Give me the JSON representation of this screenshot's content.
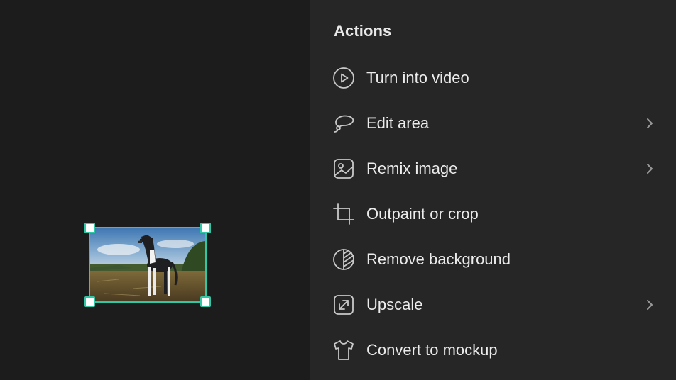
{
  "panel": {
    "title": "Actions",
    "actions": [
      {
        "label": "Turn into video",
        "icon": "play-circle-icon",
        "has_submenu": false
      },
      {
        "label": "Edit area",
        "icon": "lasso-icon",
        "has_submenu": true
      },
      {
        "label": "Remix image",
        "icon": "image-icon",
        "has_submenu": true
      },
      {
        "label": "Outpaint or crop",
        "icon": "crop-icon",
        "has_submenu": false
      },
      {
        "label": "Remove background",
        "icon": "remove-background-icon",
        "has_submenu": false
      },
      {
        "label": "Upscale",
        "icon": "upscale-icon",
        "has_submenu": true
      },
      {
        "label": "Convert to mockup",
        "icon": "tshirt-icon",
        "has_submenu": false
      }
    ]
  },
  "canvas": {
    "selected_image": "dog-photo",
    "selection_color": "#2fc7a6"
  },
  "colors": {
    "canvas_bg": "#1c1c1c",
    "panel_bg": "#262626",
    "text": "#ececec",
    "icon": "#c9c9c9"
  }
}
